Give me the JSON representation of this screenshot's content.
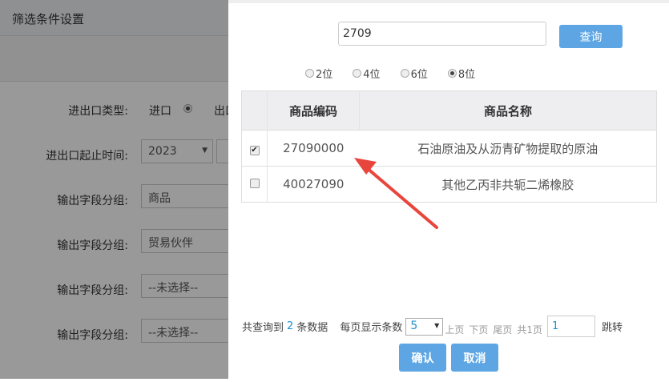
{
  "page": {
    "title": "筛选条件设置",
    "fields": [
      {
        "label": "进出口类型:",
        "value": "进口",
        "extra": "出口"
      },
      {
        "label": "进出口起止时间:",
        "value": "2023"
      },
      {
        "label": "输出字段分组:",
        "value": "商品"
      },
      {
        "label": "输出字段分组:",
        "value": "贸易伙伴"
      },
      {
        "label": "输出字段分组:",
        "value": "--未选择--"
      },
      {
        "label": "输出字段分组:",
        "value": "--未选择--"
      }
    ]
  },
  "modal": {
    "search_value": "2709",
    "search_button": "查询",
    "digits": [
      {
        "label": "2位",
        "checked": false
      },
      {
        "label": "4位",
        "checked": false
      },
      {
        "label": "6位",
        "checked": false
      },
      {
        "label": "8位",
        "checked": true
      }
    ],
    "columns": [
      "商品编码",
      "商品名称"
    ],
    "rows": [
      {
        "code": "27090000",
        "name": "石油原油及从沥青矿物提取的原油",
        "checked": true
      },
      {
        "code": "40027090",
        "name": "其他乙丙非共轭二烯橡胶",
        "checked": false
      }
    ],
    "pager": {
      "prefix": "共查询到",
      "count": "2",
      "suffix": "条数据",
      "per_page_label": "每页显示条数",
      "per_page": "5",
      "prev": "上页",
      "next": "下页",
      "last": "尾页",
      "total_pages": "共1页",
      "jump_value": "1",
      "jump": "跳转"
    },
    "confirm": "确认",
    "cancel": "取消"
  },
  "colors": {
    "accent": "#5ea6e3",
    "arrow": "#e8453c"
  }
}
